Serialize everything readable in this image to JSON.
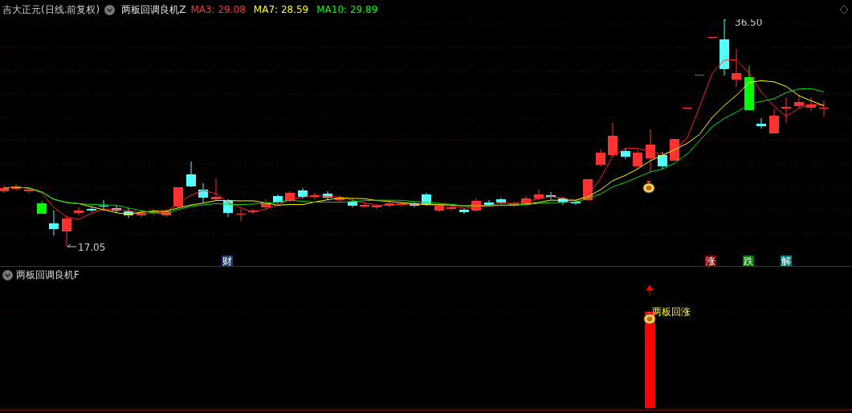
{
  "header": {
    "stock_title": "吉大正元(日线.前复权)",
    "indicator_name": "两板回调良机Z",
    "moving_averages": [
      {
        "label": "MA3: 29.08",
        "color": "#ff3232"
      },
      {
        "label": "MA7: 28.59",
        "color": "#ffff00"
      },
      {
        "label": "MA10: 29.89",
        "color": "#00ff00"
      }
    ]
  },
  "main_chart": {
    "high_label": "36.50",
    "low_label": "17.05",
    "event_markers": [
      {
        "text": "财",
        "color": "#1c3f73"
      },
      {
        "text": "涨",
        "color": "#8b0000"
      },
      {
        "text": "跌",
        "color": "#007a00"
      },
      {
        "text": "解",
        "color": "#008080"
      }
    ]
  },
  "lower_panel": {
    "title": "两板回调良机F",
    "signal_label": "两板回涨"
  }
}
